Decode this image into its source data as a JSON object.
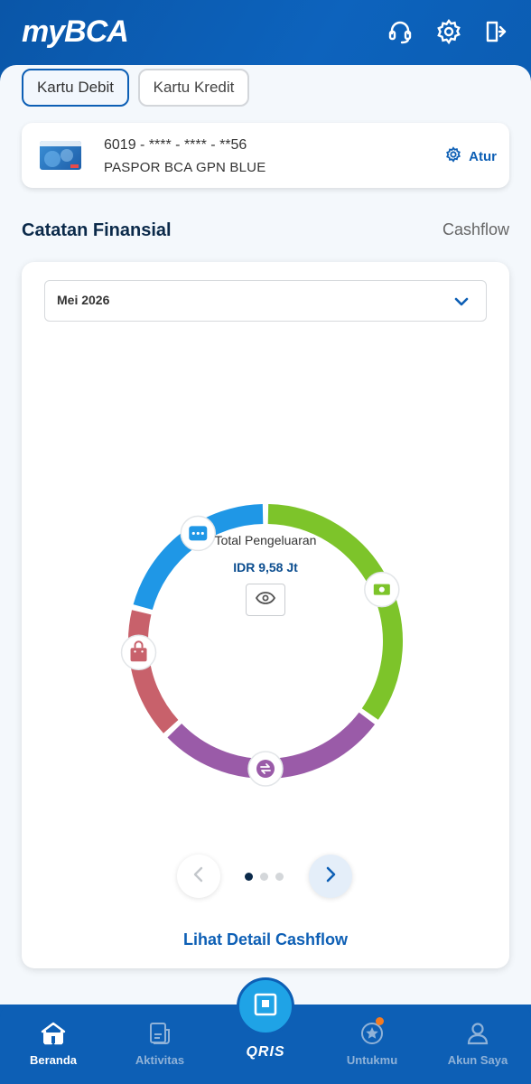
{
  "header": {
    "logo_my": "my",
    "logo_bca": "BCA",
    "icons": [
      "headset-icon",
      "gear-icon",
      "logout-icon"
    ]
  },
  "tabs": [
    {
      "label": "Kartu Debit",
      "active": true
    },
    {
      "label": "Kartu Kredit",
      "active": false
    }
  ],
  "card": {
    "number": "6019 - **** - **** - **56",
    "name": "PASPOR BCA GPN BLUE",
    "settings_label": "Atur"
  },
  "section": {
    "title": "Catatan Finansial",
    "right_label": "Cashflow"
  },
  "chart_card": {
    "month": "Mei 2026",
    "center_label": "Total Pengeluaran",
    "center_value": "IDR 9,58 Jt",
    "detail_link": "Lihat Detail Cashflow",
    "page_count": 3,
    "active_page": 0
  },
  "chart_data": {
    "type": "pie",
    "variant": "donut",
    "segments": [
      {
        "color": "#7dc42a",
        "share": 0.35,
        "icon": "money-icon"
      },
      {
        "color": "#9a5ba8",
        "share": 0.28,
        "icon": "transfer-icon"
      },
      {
        "color": "#c8616b",
        "share": 0.16,
        "icon": "shopping-bag-icon"
      },
      {
        "color": "#1f97e6",
        "share": 0.21,
        "icon": "chat-dots-icon"
      }
    ]
  },
  "bottom_nav": {
    "items": [
      {
        "label": "Beranda",
        "active": true,
        "icon": "home-icon"
      },
      {
        "label": "Aktivitas",
        "active": false,
        "icon": "receipt-icon"
      },
      {
        "label": "Untukmu",
        "active": false,
        "icon": "star-badge-icon"
      },
      {
        "label": "Akun Saya",
        "active": false,
        "icon": "user-icon"
      }
    ],
    "qris_label": "QRIS"
  },
  "colors": {
    "brand": "#0d5fb5",
    "accent_light": "#1fa3e6",
    "notification": "#f47b20"
  }
}
